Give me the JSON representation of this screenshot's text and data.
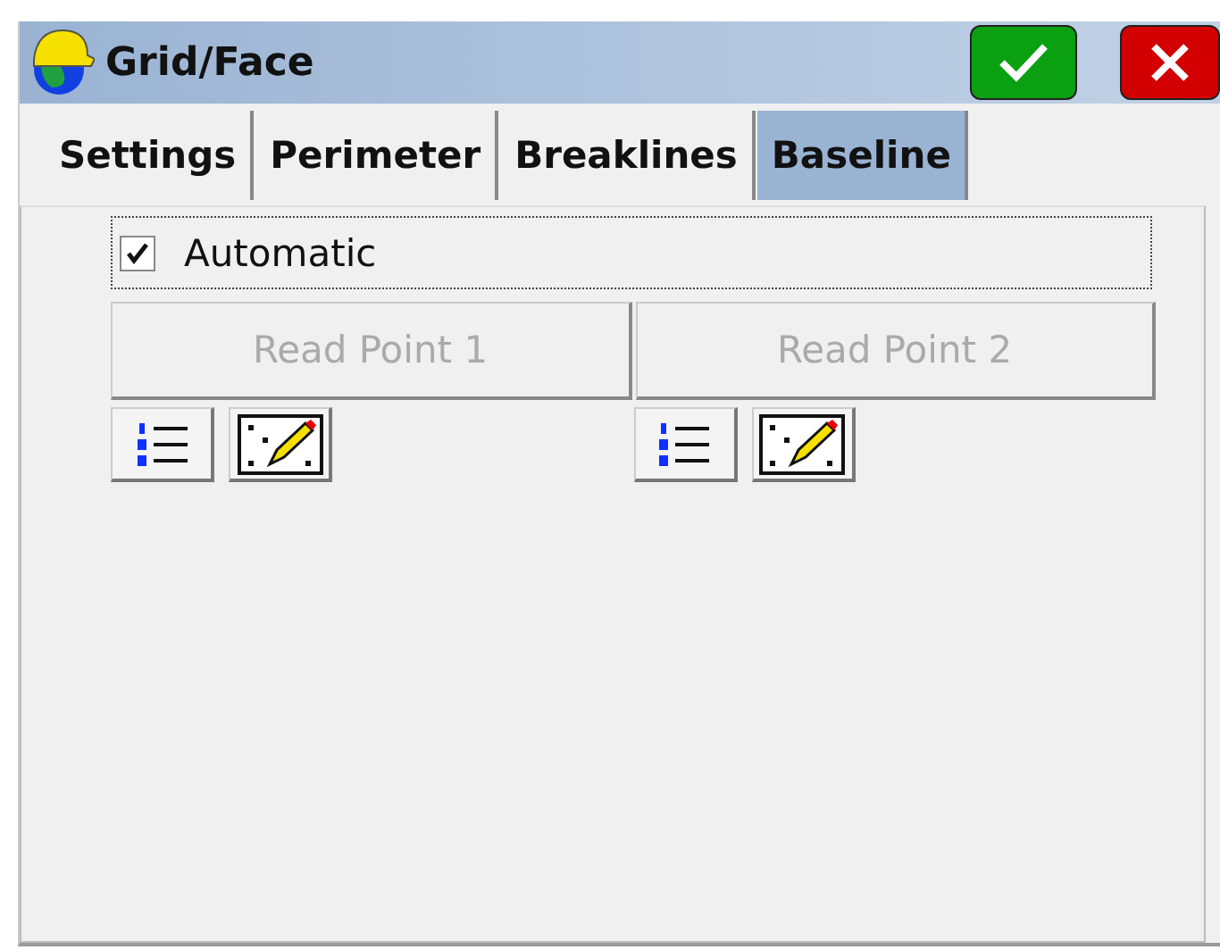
{
  "window": {
    "title": "Grid/Face"
  },
  "tabs": [
    {
      "label": "Settings",
      "selected": false
    },
    {
      "label": "Perimeter",
      "selected": false
    },
    {
      "label": "Breaklines",
      "selected": false
    },
    {
      "label": "Baseline",
      "selected": true
    }
  ],
  "automatic": {
    "label": "Automatic",
    "checked": true
  },
  "read_buttons": [
    {
      "label": "Read Point 1",
      "disabled": true
    },
    {
      "label": "Read Point 2",
      "disabled": true
    }
  ]
}
